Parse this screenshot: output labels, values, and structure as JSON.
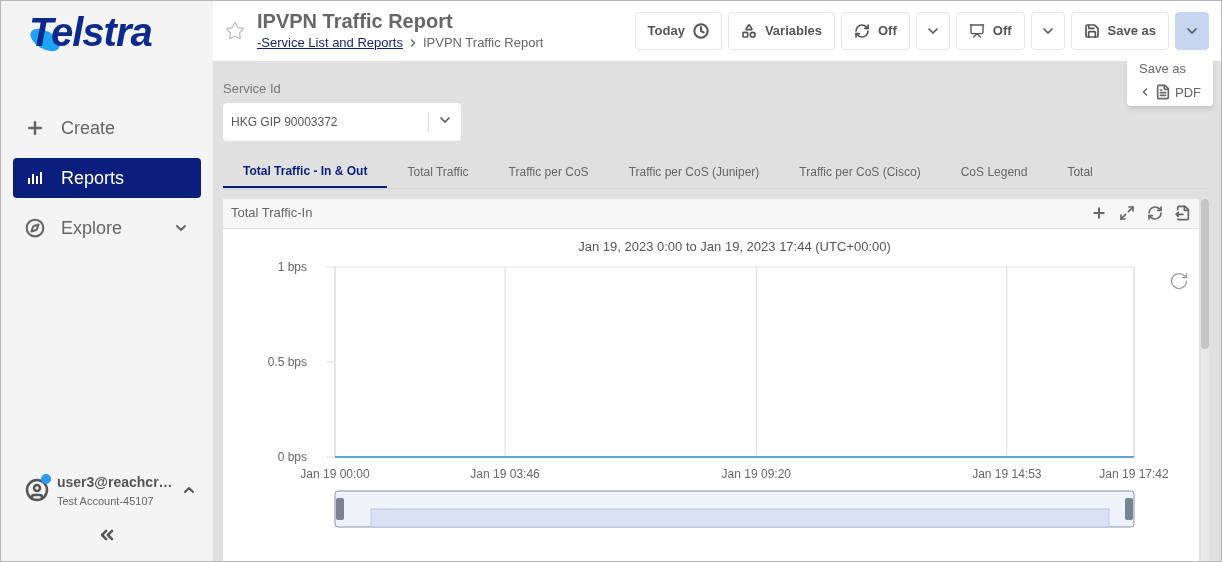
{
  "sidebar": {
    "logo": "Telstra",
    "items": [
      {
        "label": "Create",
        "kind": "action",
        "selected": false
      },
      {
        "label": "Reports",
        "kind": "reports",
        "selected": true
      },
      {
        "label": "Explore",
        "kind": "group",
        "selected": false,
        "expanded": false
      }
    ],
    "user": {
      "name": "user3@reachcr…",
      "account": "Test Account-45107"
    }
  },
  "header": {
    "title": "IPVPN Traffic Report",
    "favorite": false,
    "breadcrumb": [
      {
        "label": "-Service List and Reports",
        "kind": "link"
      },
      {
        "label": "IPVPN Traffic Report",
        "kind": "current"
      }
    ]
  },
  "toolbar": [
    {
      "kind": "time",
      "label": "Today",
      "selected": false
    },
    {
      "kind": "variables",
      "label": "Variables",
      "selected": false
    },
    {
      "kind": "refresh",
      "label": "Off",
      "selected": false
    },
    {
      "kind": "caret",
      "selected": false
    },
    {
      "kind": "kiosk",
      "label": "Off",
      "selected": false
    },
    {
      "kind": "caret",
      "selected": false
    },
    {
      "kind": "save",
      "label": "Save as",
      "selected": false
    },
    {
      "kind": "caret",
      "selected": true
    }
  ],
  "menu": {
    "title": "Save as",
    "items": [
      {
        "label": "PDF"
      }
    ]
  },
  "filter": {
    "label": "Service Id",
    "value": "HKG GIP 90003372"
  },
  "tabs": [
    {
      "label": "Total Traffic - In & Out",
      "selected": true
    },
    {
      "label": "Total Traffic",
      "selected": false
    },
    {
      "label": "Traffic per CoS",
      "selected": false
    },
    {
      "label": "Traffic per CoS (Juniper)",
      "selected": false
    },
    {
      "label": "Traffic per CoS (Cisco)",
      "selected": false
    },
    {
      "label": "CoS Legend",
      "selected": false
    },
    {
      "label": "Total",
      "selected": false
    }
  ],
  "panel": {
    "title": "Total Traffic-In",
    "chart_data": {
      "type": "line",
      "title": "Jan 19, 2023 0:00 to Jan 19, 2023 17:44 (UTC+00:00)",
      "categories": [
        "Jan 19 00:00",
        "Jan 19 03:46",
        "Jan 19 09:20",
        "Jan 19 14:53",
        "Jan 19 17:42"
      ],
      "series": [
        {
          "color": "#5aa5e0",
          "values": [
            0,
            0,
            0,
            0,
            0
          ]
        }
      ],
      "ylim": [
        0,
        1
      ],
      "grid": true,
      "yticks": [
        {
          "value": 0,
          "label": "0 bps"
        },
        {
          "value": 0.5,
          "label": "0.5 bps"
        },
        {
          "value": 1,
          "label": "1 bps"
        }
      ]
    }
  }
}
